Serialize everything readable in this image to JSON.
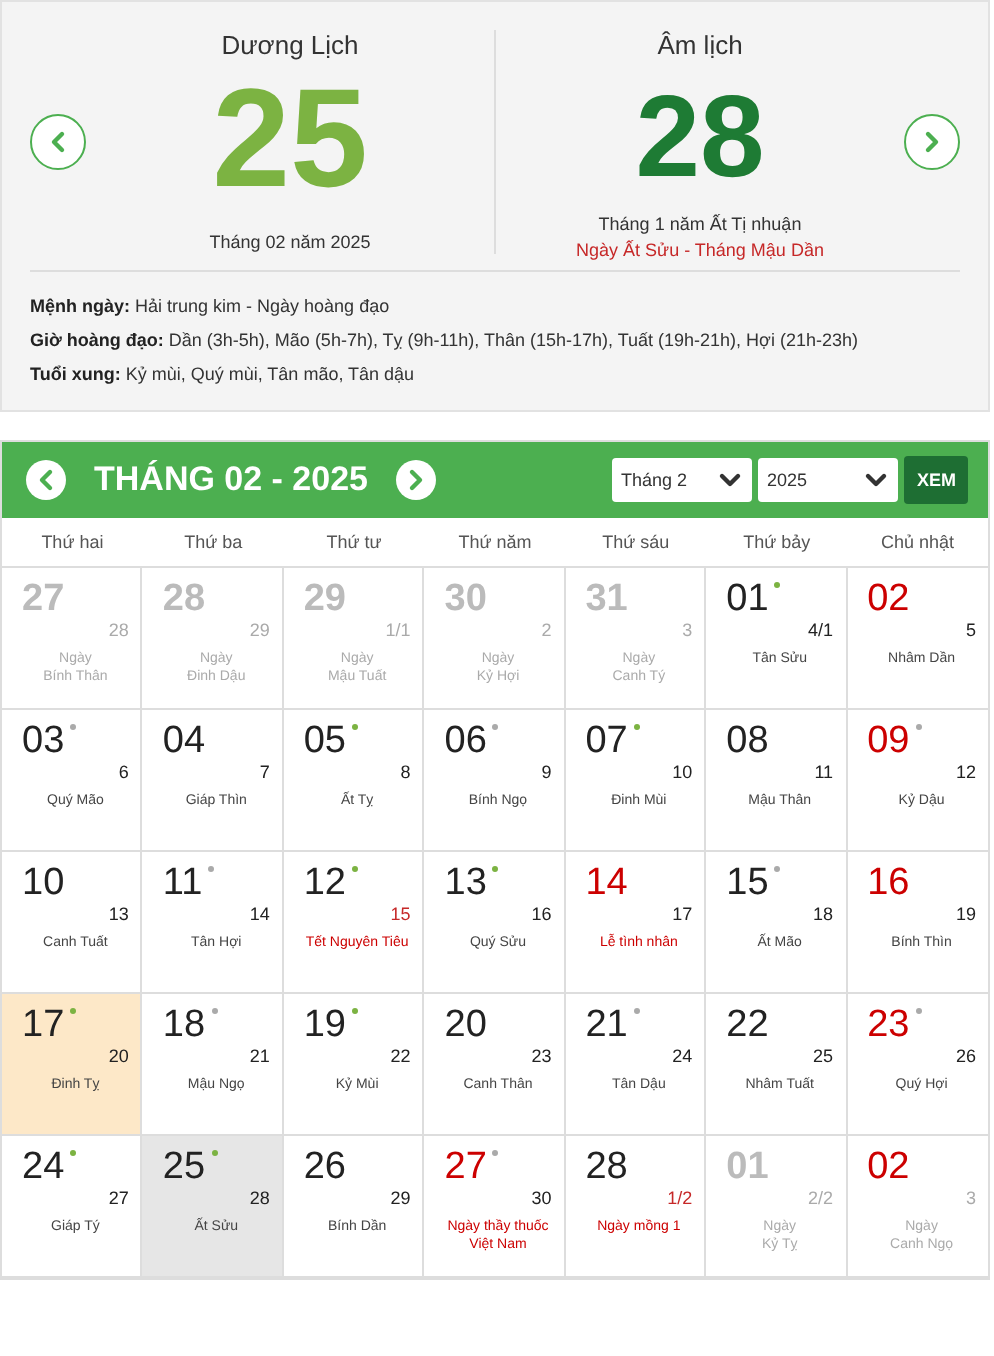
{
  "solar": {
    "title": "Dương Lịch",
    "day": "25",
    "subtitle": "Tháng 02 năm 2025"
  },
  "lunar": {
    "title": "Âm lịch",
    "day": "28",
    "subtitle": "Tháng 1 năm Ất Tị nhuận",
    "detail": "Ngày Ất Sửu - Tháng Mậu Dần"
  },
  "info": [
    "**Mệnh ngày:** Hải trung kim - Ngày hoàng đạo",
    "**Giờ hoàng đạo:** Dần (3h-5h), Mão (5h-7h), Tỵ (9h-11h), Thân (15h-17h), Tuất (19h-21h), Hợi (21h-23h)",
    "**Tuổi xung:** Kỷ mùi, Quý mùi, Tân mão, Tân dậu"
  ],
  "calendar": {
    "title": "THÁNG 02 - 2025",
    "month_select": "Tháng 2",
    "year_select": "2025",
    "view_button": "XEM",
    "weekdays": [
      "Thứ hai",
      "Thứ ba",
      "Thứ tư",
      "Thứ năm",
      "Thứ sáu",
      "Thứ bảy",
      "Chủ nhật"
    ],
    "days": [
      {
        "day": "27",
        "lunar": "28",
        "prefix": "Ngày",
        "label": "Bính Thân",
        "outside": true,
        "holiday": false,
        "selected": false,
        "today": false
      },
      {
        "day": "28",
        "lunar": "29",
        "prefix": "Ngày",
        "label": "Đinh Dậu",
        "outside": true,
        "holiday": false,
        "selected": false,
        "today": false
      },
      {
        "day": "29",
        "lunar": "1/1",
        "prefix": "Ngày",
        "label": "Mậu Tuất",
        "outside": true,
        "holiday": false,
        "selected": false,
        "today": false
      },
      {
        "day": "30",
        "lunar": "2",
        "prefix": "Ngày",
        "label": "Kỷ Hợi",
        "outside": true,
        "holiday": false,
        "selected": false,
        "today": false
      },
      {
        "day": "31",
        "lunar": "3",
        "prefix": "Ngày",
        "label": "Canh Tý",
        "outside": true,
        "holiday": false,
        "selected": false,
        "today": false
      },
      {
        "day": "01",
        "lunar": "4/1",
        "label": "Tân Sửu",
        "color": "#7cb342",
        "outside": false,
        "holiday": false,
        "selected": false,
        "today": false
      },
      {
        "day": "02",
        "lunar": "5",
        "label": "Nhâm Dần",
        "outside": false,
        "holiday": true,
        "selected": false,
        "today": false
      },
      {
        "day": "03",
        "lunar": "6",
        "label": "Quý Mão",
        "color": "#aaaaaa",
        "outside": false,
        "holiday": false,
        "selected": false,
        "today": false
      },
      {
        "day": "04",
        "lunar": "7",
        "label": "Giáp Thìn",
        "outside": false,
        "holiday": false,
        "selected": false,
        "today": false
      },
      {
        "day": "05",
        "lunar": "8",
        "label": "Ất Tỵ",
        "color": "#7cb342",
        "outside": false,
        "holiday": false,
        "selected": false,
        "today": false
      },
      {
        "day": "06",
        "lunar": "9",
        "label": "Bính Ngọ",
        "color": "#aaaaaa",
        "outside": false,
        "holiday": false,
        "selected": false,
        "today": false
      },
      {
        "day": "07",
        "lunar": "10",
        "label": "Đinh Mùi",
        "color": "#7cb342",
        "outside": false,
        "holiday": false,
        "selected": false,
        "today": false
      },
      {
        "day": "08",
        "lunar": "11",
        "label": "Mậu Thân",
        "outside": false,
        "holiday": false,
        "selected": false,
        "today": false
      },
      {
        "day": "09",
        "lunar": "12",
        "label": "Kỷ Dậu",
        "color": "#aaaaaa",
        "outside": false,
        "holiday": true,
        "selected": false,
        "today": false
      },
      {
        "day": "10",
        "lunar": "13",
        "label": "Canh Tuất",
        "outside": false,
        "holiday": false,
        "selected": false,
        "today": false
      },
      {
        "day": "11",
        "lunar": "14",
        "label": "Tân Hợi",
        "color": "#aaaaaa",
        "outside": false,
        "holiday": false,
        "selected": false,
        "today": false
      },
      {
        "day": "12",
        "lunar": "15",
        "label": "Tết Nguyên Tiêu",
        "event": true,
        "lunar_red": true,
        "color": "#7cb342",
        "outside": false,
        "holiday": false,
        "selected": false,
        "today": false
      },
      {
        "day": "13",
        "lunar": "16",
        "label": "Quý Sửu",
        "color": "#7cb342",
        "outside": false,
        "holiday": false,
        "selected": false,
        "today": false
      },
      {
        "day": "14",
        "lunar": "17",
        "label": "Lễ tình nhân",
        "event": true,
        "outside": false,
        "holiday": true,
        "selected": false,
        "today": false
      },
      {
        "day": "15",
        "lunar": "18",
        "label": "Ất Mão",
        "color": "#aaaaaa",
        "outside": false,
        "holiday": false,
        "selected": false,
        "today": false
      },
      {
        "day": "16",
        "lunar": "19",
        "label": "Bính Thìn",
        "outside": false,
        "holiday": true,
        "selected": false,
        "today": false
      },
      {
        "day": "17",
        "lunar": "20",
        "label": "Đinh Tỵ",
        "color": "#7cb342",
        "outside": false,
        "holiday": false,
        "selected": false,
        "today": true
      },
      {
        "day": "18",
        "lunar": "21",
        "label": "Mậu Ngọ",
        "color": "#aaaaaa",
        "outside": false,
        "holiday": false,
        "selected": false,
        "today": false
      },
      {
        "day": "19",
        "lunar": "22",
        "label": "Kỷ Mùi",
        "color": "#7cb342",
        "outside": false,
        "holiday": false,
        "selected": false,
        "today": false
      },
      {
        "day": "20",
        "lunar": "23",
        "label": "Canh Thân",
        "outside": false,
        "holiday": false,
        "selected": false,
        "today": false
      },
      {
        "day": "21",
        "lunar": "24",
        "label": "Tân Dậu",
        "color": "#aaaaaa",
        "outside": false,
        "holiday": false,
        "selected": false,
        "today": false
      },
      {
        "day": "22",
        "lunar": "25",
        "label": "Nhâm Tuất",
        "outside": false,
        "holiday": false,
        "selected": false,
        "today": false
      },
      {
        "day": "23",
        "lunar": "26",
        "label": "Quý Hợi",
        "color": "#aaaaaa",
        "outside": false,
        "holiday": true,
        "selected": false,
        "today": false
      },
      {
        "day": "24",
        "lunar": "27",
        "label": "Giáp Tý",
        "color": "#7cb342",
        "outside": false,
        "holiday": false,
        "selected": false,
        "today": false
      },
      {
        "day": "25",
        "lunar": "28",
        "label": "Ất Sửu",
        "color": "#7cb342",
        "outside": false,
        "holiday": false,
        "selected": true,
        "today": false
      },
      {
        "day": "26",
        "lunar": "29",
        "label": "Bính Dần",
        "outside": false,
        "holiday": false,
        "selected": false,
        "today": false
      },
      {
        "day": "27",
        "lunar": "30",
        "label": "Ngày thầy thuốc Việt Nam",
        "event": true,
        "color": "#aaaaaa",
        "outside": false,
        "holiday": true,
        "selected": false,
        "today": false
      },
      {
        "day": "28",
        "lunar": "1/2",
        "label": "Ngày mồng 1",
        "event": true,
        "lunar_red": true,
        "outside": false,
        "holiday": false,
        "selected": false,
        "today": false
      },
      {
        "day": "01",
        "lunar": "2/2",
        "prefix": "Ngày",
        "label": "Kỷ Tỵ",
        "outside": true,
        "holiday": false,
        "selected": false,
        "today": false
      },
      {
        "day": "02",
        "lunar": "3",
        "prefix": "Ngày",
        "label": "Canh Ngọ",
        "outside": true,
        "holiday": true,
        "selected": false,
        "today": false
      }
    ]
  }
}
